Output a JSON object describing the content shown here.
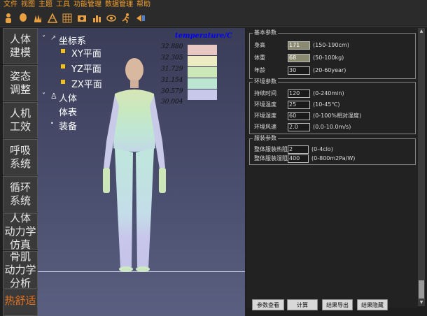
{
  "menu": [
    "文件",
    "视图",
    "主题",
    "工具",
    "功能管理",
    "数据管理",
    "帮助"
  ],
  "toolbar_icons": [
    "person-icon",
    "head-icon",
    "hand-icon",
    "mesh-icon",
    "grid-icon",
    "camera-icon",
    "chart-icon",
    "eye-icon",
    "run-icon",
    "fluid-icon"
  ],
  "nav": [
    "人体\n建模",
    "姿态\n调整",
    "人机\n工效",
    "呼吸\n系统",
    "循环\n系统",
    "人体\n动力学\n仿真",
    "骨肌\n动力学\n分析",
    "热舒适"
  ],
  "tree": {
    "root": "坐标系",
    "xy": "XY平面",
    "yz": "YZ平面",
    "zx": "ZX平面",
    "body": "人体",
    "surface": "体表",
    "equip": "装备"
  },
  "legend": {
    "title": "temperature/C",
    "labels": [
      "32.880",
      "32.305",
      "31.729",
      "31.154",
      "30.579",
      "30.004"
    ],
    "colors": [
      "#e9c8c4",
      "#ecebc2",
      "#cde8b8",
      "#bde6d2",
      "#c8c9ea"
    ]
  },
  "basic": {
    "title": "基本参数",
    "height_label": "身高",
    "height_val": "171",
    "height_hint": "(150-190cm)",
    "weight_label": "体重",
    "weight_val": "68",
    "weight_hint": "(50-100kg)",
    "age_label": "年龄",
    "age_val": "30",
    "age_hint": "(20-60year)"
  },
  "env": {
    "title": "环境参数",
    "dur_label": "持续时间",
    "dur_val": "120",
    "dur_hint": "(0-240min)",
    "temp_label": "环境温度",
    "temp_val": "25",
    "temp_hint": "(10-45℃)",
    "hum_label": "环境湿度",
    "hum_val": "60",
    "hum_hint": "(0-100%相对湿度)",
    "wind_label": "环境风速",
    "wind_val": "2.0",
    "wind_hint": "(0.0-10.0m/s)"
  },
  "cloth": {
    "title": "服装参数",
    "heat_label": "整体服装热阻",
    "heat_val": "2",
    "heat_hint": "(0-4clo)",
    "wet_label": "整体服装湿阻",
    "wet_val": "400",
    "wet_hint": "(0-800m2Pa/W)"
  },
  "buttons": [
    "参数查看",
    "计算",
    "结果导出",
    "结果隐藏"
  ]
}
